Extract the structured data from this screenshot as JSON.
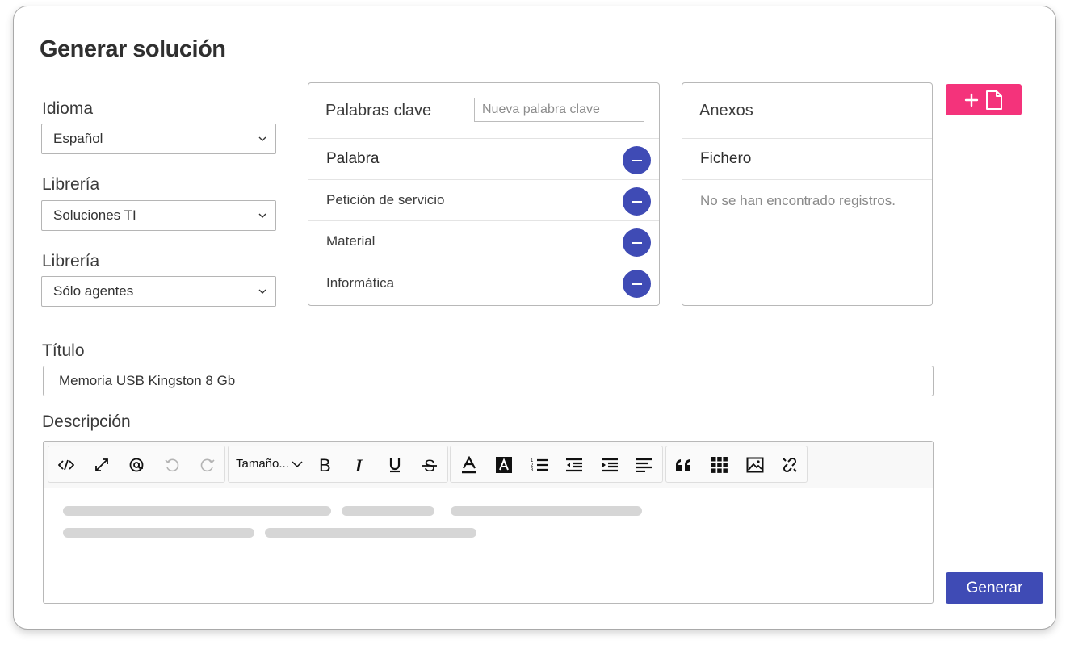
{
  "page_title": "Generar solución",
  "fields": {
    "idioma": {
      "label": "Idioma",
      "value": "Español"
    },
    "libreria1": {
      "label": "Librería",
      "value": "Soluciones TI"
    },
    "libreria2": {
      "label": "Librería",
      "value": "Sólo agentes"
    }
  },
  "keywords": {
    "title": "Palabras clave",
    "input_placeholder": "Nueva palabra clave",
    "header": "Palabra",
    "items": [
      "Petición de servicio",
      "Material",
      "Informática"
    ]
  },
  "attachments": {
    "title": "Anexos",
    "header": "Fichero",
    "empty_message": "No se han encontrado registros."
  },
  "titulo": {
    "label": "Título",
    "value": "Memoria USB Kingston 8 Gb"
  },
  "descripcion": {
    "label": "Descripción",
    "toolbar": {
      "size_label": "Tamaño...",
      "buttons": [
        "code-view",
        "fullscreen",
        "mention",
        "undo",
        "redo",
        "font-size",
        "bold",
        "italic",
        "underline",
        "strikethrough",
        "font-color",
        "highlight-color",
        "ordered-list",
        "outdent",
        "indent",
        "align",
        "blockquote",
        "table",
        "image",
        "unlink"
      ]
    }
  },
  "actions": {
    "add_file": "+",
    "generate": "Generar"
  },
  "colors": {
    "primary": "#3f4bb5",
    "accent": "#f4337b"
  }
}
